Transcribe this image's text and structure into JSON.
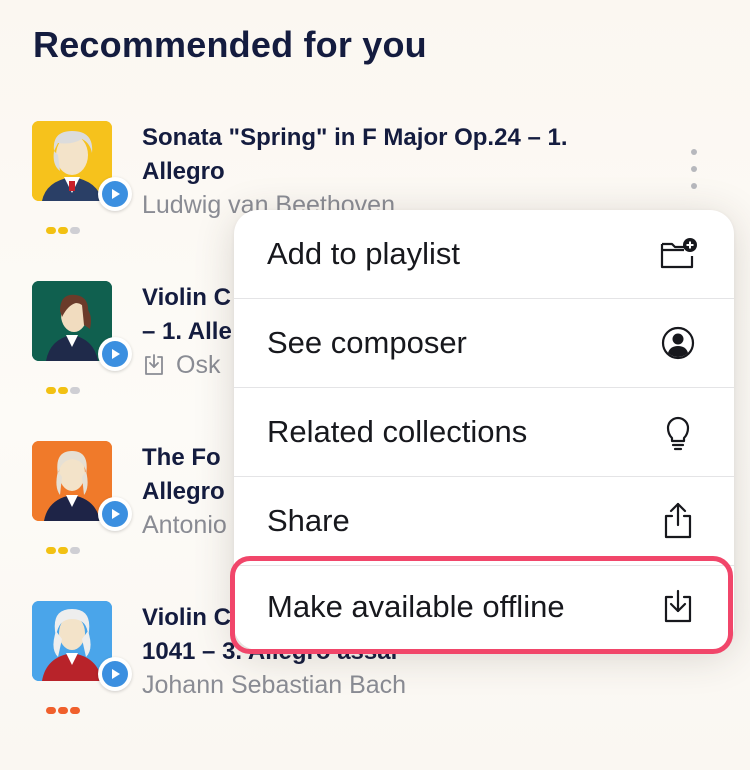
{
  "page": {
    "title": "Recommended for you"
  },
  "tracks": [
    {
      "title": "Sonata \"Spring\" in F Major Op.24 – 1. Allegro",
      "artist": "Ludwig van Beethoven",
      "art_bg": "#f6c21c",
      "dots": [
        "#f2c113",
        "#f2c113",
        "#cfcfd4"
      ]
    },
    {
      "title": "Violin C",
      "title_line2": "– 1. Alle",
      "artist": "Osk",
      "artist_icon": "download-icon",
      "art_bg": "#10604f",
      "dots": [
        "#f2c113",
        "#f2c113",
        "#cfcfd4"
      ]
    },
    {
      "title": "The Fo",
      "title_line2": "Allegro",
      "artist": "Antonio",
      "art_bg": "#f07a2a",
      "dots": [
        "#f2c113",
        "#f2c113",
        "#cfcfd4"
      ]
    },
    {
      "title": "Violin C",
      "title_line2": "1041 – 3. Allegro assai",
      "artist": "Johann Sebastian Bach",
      "art_bg": "#4aa5ea",
      "dots": [
        "#f0602c",
        "#f0602c",
        "#f0602c"
      ]
    }
  ],
  "menu": {
    "items": [
      {
        "label": "Add to playlist",
        "icon": "folder-add-icon"
      },
      {
        "label": "See composer",
        "icon": "person-circle-icon"
      },
      {
        "label": "Related collections",
        "icon": "lightbulb-icon"
      },
      {
        "label": "Share",
        "icon": "share-icon"
      },
      {
        "label": "Make available offline",
        "icon": "download-icon",
        "highlighted": true
      }
    ]
  },
  "colors": {
    "title": "#141c3f",
    "play_accent": "#3b8fe0",
    "highlight_border": "#f1466a",
    "secondary_text": "#8a8c94"
  }
}
